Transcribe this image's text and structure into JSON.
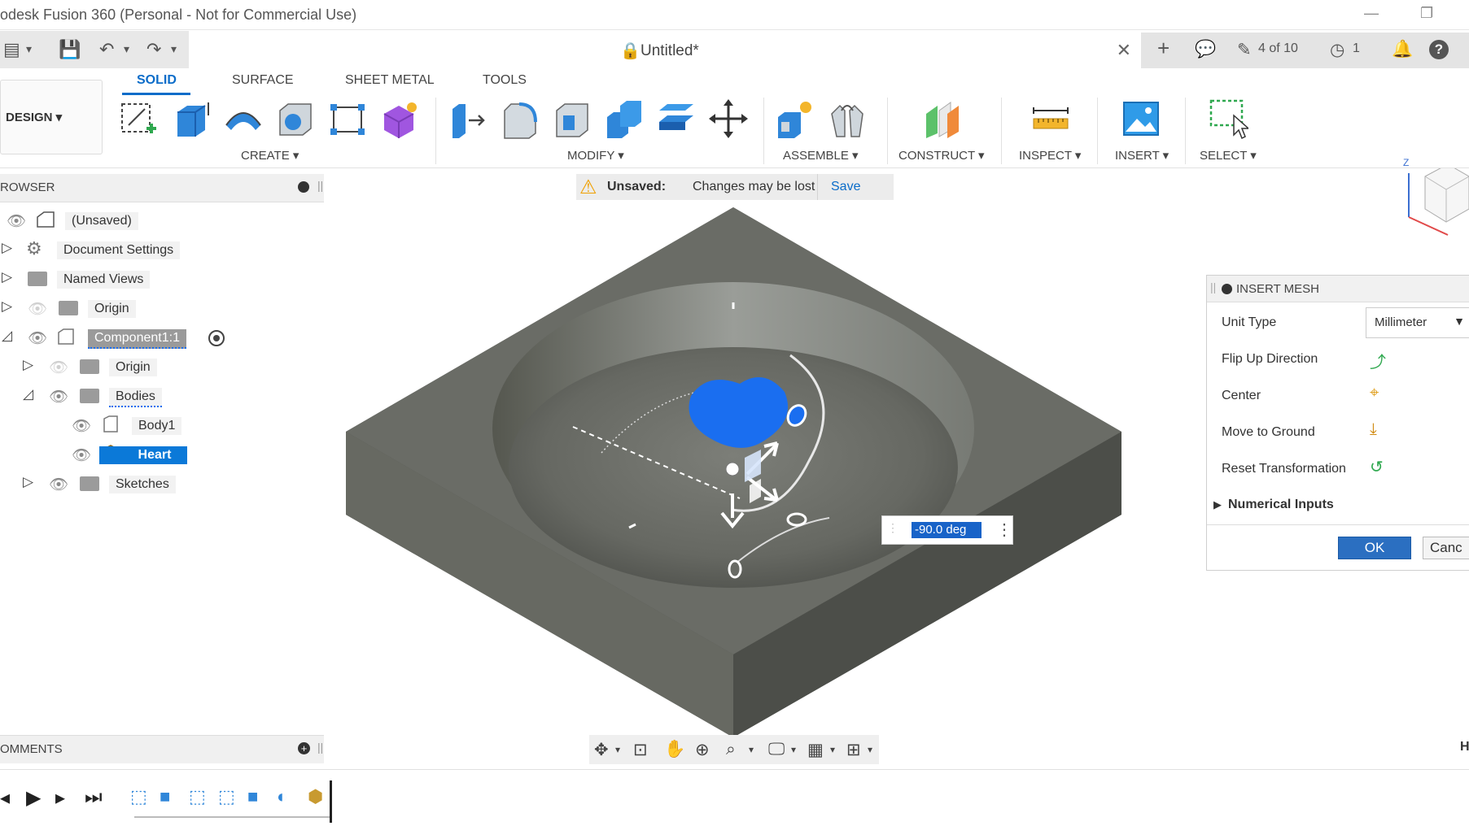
{
  "window": {
    "title": "odesk Fusion 360 (Personal - Not for Commercial Use)",
    "minimize": "—",
    "restore": "❐"
  },
  "qab": {
    "file": "▤",
    "save": "💾",
    "undo": "↶",
    "redo": "↷",
    "dropdown": "▾"
  },
  "doc_tab": {
    "title": "Untitled*",
    "lock": "🔒",
    "close": "✕"
  },
  "right_bar": {
    "new_tab": "+",
    "comments": "💬",
    "jobs_label": "4 of 10",
    "jobs_icon": "✎",
    "clock_label": "1",
    "clock_icon": "◷",
    "bell": "🔔",
    "help": "?"
  },
  "workspace": {
    "label": "DESIGN ▾"
  },
  "tabs": [
    {
      "label": "SOLID",
      "active": true
    },
    {
      "label": "SURFACE"
    },
    {
      "label": "SHEET METAL"
    },
    {
      "label": "TOOLS"
    }
  ],
  "groups": {
    "create": "CREATE ▾",
    "modify": "MODIFY ▾",
    "assemble": "ASSEMBLE ▾",
    "construct": "CONSTRUCT ▾",
    "inspect": "INSPECT ▾",
    "insert": "INSERT ▾",
    "select": "SELECT ▾"
  },
  "browser": {
    "header": "ROWSER",
    "items": {
      "root": "(Unsaved)",
      "doc_settings": "Document Settings",
      "named_views": "Named Views",
      "origin": "Origin",
      "component": "Component1:1",
      "sub_origin": "Origin",
      "bodies": "Bodies",
      "body1": "Body1",
      "heart": "Heart",
      "sketches": "Sketches"
    }
  },
  "banner": {
    "status": "Unsaved:",
    "message": "Changes may be lost",
    "save": "Save"
  },
  "insert_mesh": {
    "title": "INSERT MESH",
    "unit_type_label": "Unit Type",
    "unit_type_value": "Millimeter",
    "flip_label": "Flip Up Direction",
    "center_label": "Center",
    "ground_label": "Move to Ground",
    "reset_label": "Reset Transformation",
    "numerical_label": "Numerical Inputs",
    "ok": "OK",
    "cancel": "Canc"
  },
  "angle_input": {
    "value": "-90.0 deg"
  },
  "comments": {
    "header": "OMMENTS"
  },
  "viewcube": {
    "axis": "Z"
  },
  "corner_label": "H",
  "colors": {
    "accent": "#0b6cc9",
    "body_top": "#6a6c66",
    "heart": "#1a6ef0"
  }
}
